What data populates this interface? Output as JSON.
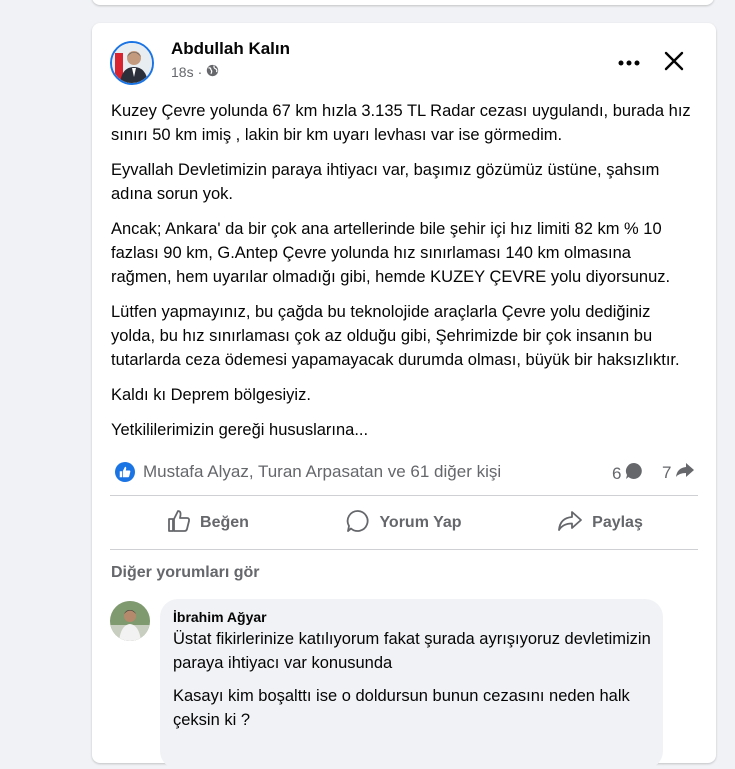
{
  "post": {
    "author": "Abdullah Kalın",
    "time": "18s",
    "time_separator": "·",
    "paragraphs": [
      "Kuzey Çevre yolunda 67 km hızla 3.135 TL Radar cezası uygulandı, burada hız sınırı 50 km imiş , lakin bir km uyarı levhası var ise görmedim.",
      "Eyvallah Devletimizin paraya ihtiyacı var, başımız gözümüz üstüne, şahsım adına sorun yok.",
      "Ancak;  Ankara' da bir çok ana artellerinde bile şehir içi hız limiti 82 km % 10 fazlası 90 km, G.Antep Çevre yolunda hız sınırlaması 140 km olmasına rağmen, hem uyarılar olmadığı gibi, hemde KUZEY ÇEVRE yolu diyorsunuz.",
      "Lütfen yapmayınız, bu çağda bu teknolojide araçlarla Çevre yolu dediğiniz yolda, bu hız sınırlaması çok az olduğu gibi, Şehrimizde bir çok insanın bu tutarlarda ceza ödemesi yapamayacak durumda olması, büyük bir haksızlıktır.",
      "Kaldı kı Deprem bölgesiyiz.",
      "Yetkililerimizin gereği hususlarına..."
    ]
  },
  "reactions": {
    "names": "Mustafa Alyaz, Turan Arpasatan ve 61 diğer kişi",
    "comment_count": "6",
    "share_count": "7"
  },
  "actions": {
    "like": "Beğen",
    "comment": "Yorum Yap",
    "share": "Paylaş"
  },
  "comments": {
    "more_label": "Diğer yorumları gör",
    "first": {
      "author": "İbrahim Ağyar",
      "paragraphs": [
        "Üstat fikirlerinize katılıyorum fakat şurada ayrışıyoruz devletimizin paraya ihtiyacı var konusunda",
        "Kasayı kim boşalttı ise o doldursun bunun cezasını neden halk çeksin ki ?"
      ]
    }
  },
  "icons": {
    "globe": "globe-icon",
    "more": "more-dots-icon",
    "close": "close-icon",
    "like": "like-icon",
    "comment": "comment-icon",
    "share": "share-icon"
  },
  "colors": {
    "accent": "#1b74e4",
    "secondary_text": "#65676b",
    "background": "#f0f2f5"
  }
}
